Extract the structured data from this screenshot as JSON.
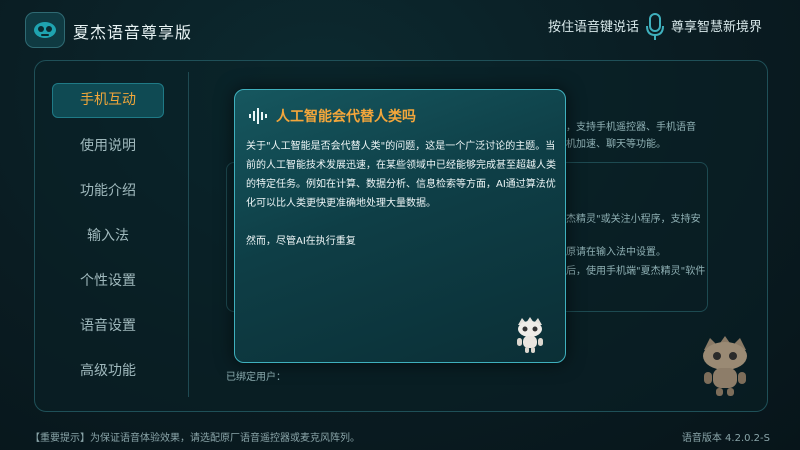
{
  "header": {
    "app_title": "夏杰语音尊享版",
    "voice_hint": "按住语音键说话",
    "slogan": "尊享智慧新境界"
  },
  "sidebar": {
    "items": [
      {
        "label": "手机互动",
        "active": true
      },
      {
        "label": "使用说明",
        "active": false
      },
      {
        "label": "功能介绍",
        "active": false
      },
      {
        "label": "输入法",
        "active": false
      },
      {
        "label": "个性设置",
        "active": false
      },
      {
        "label": "语音设置",
        "active": false
      },
      {
        "label": "高级功能",
        "active": false
      }
    ]
  },
  "background_content": {
    "line1": "，支持手机遥控器、手机语音",
    "line2": "机加速、聊天等功能。",
    "line3": "杰精灵\"或关注小程序，支持安",
    "line4": "原请在输入法中设置。",
    "line5": "后，使用手机端\"夏杰精灵\"软件",
    "bind_label": "已绑定用户："
  },
  "dialog": {
    "title": "人工智能会代替人类吗",
    "paragraph1": "关于\"人工智能是否会代替人类\"的问题，这是一个广泛讨论的主题。当前的人工智能技术发展迅速，在某些领域中已经能够完成甚至超越人类的特定任务。例如在计算、数据分析、信息检索等方面，AI通过算法优化可以比人类更快更准确地处理大量数据。",
    "paragraph2": "然而，尽管AI在执行重复"
  },
  "footer": {
    "notice": "【重要提示】为保证语音体验效果，请选配原厂语音遥控器或麦克风阵列。",
    "version": "语音版本 4.2.0.2-S"
  },
  "colors": {
    "accent": "#f3a63b",
    "dialog_border": "#3fb0bd",
    "background": "#0a1c22"
  },
  "icons": [
    "app-logo-icon",
    "microphone-icon",
    "soundwave-icon",
    "robot-mascot-icon"
  ]
}
